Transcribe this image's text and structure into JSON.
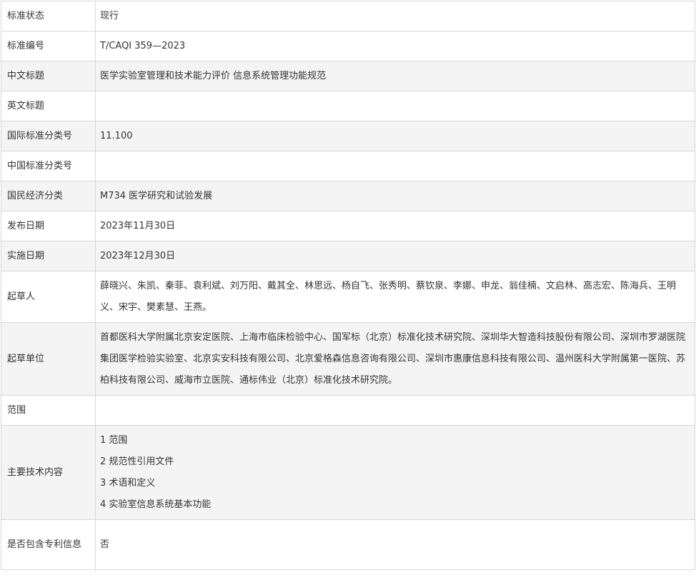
{
  "rows": [
    {
      "label": "标准状态",
      "value": "现行"
    },
    {
      "label": "标准编号",
      "value": "T/CAQI 359—2023"
    },
    {
      "label": "中文标题",
      "value": "医学实验室管理和技术能力评价 信息系统管理功能规范"
    },
    {
      "label": "英文标题",
      "value": ""
    },
    {
      "label": "国际标准分类号",
      "value": "11.100"
    },
    {
      "label": "中国标准分类号",
      "value": ""
    },
    {
      "label": "国民经济分类",
      "value": "M734 医学研究和试验发展"
    },
    {
      "label": "发布日期",
      "value": "2023年11月30日"
    },
    {
      "label": "实施日期",
      "value": "2023年12月30日"
    },
    {
      "label": "起草人",
      "value": "薛晓兴、朱凯、秦菲、袁利斌、刘万阳、戴其全、林思远、杨自飞、张秀明、蔡钦泉、李娜、申龙、翁佳楠、文启林、高志宏、陈海兵、王明义、宋宇、樊素慧、王燕。"
    },
    {
      "label": "起草单位",
      "value": "首都医科大学附属北京安定医院、上海市临床检验中心、国军标（北京）标准化技术研究院、深圳华大智造科技股份有限公司、深圳市罗湖医院集团医学检验实验室、北京实安科技有限公司、北京爱格森信息咨询有限公司、深圳市惠康信息科技有限公司、温州医科大学附属第一医院、苏柏科技有限公司、威海市立医院、通标伟业（北京）标准化技术研究院。"
    },
    {
      "label": "范围",
      "value": ""
    },
    {
      "label": "主要技术内容",
      "items": [
        "1 范围",
        "2 规范性引用文件",
        "3 术语和定义",
        "4 实验室信息系统基本功能"
      ]
    },
    {
      "label": "是否包含专利信息",
      "value": "否"
    }
  ]
}
